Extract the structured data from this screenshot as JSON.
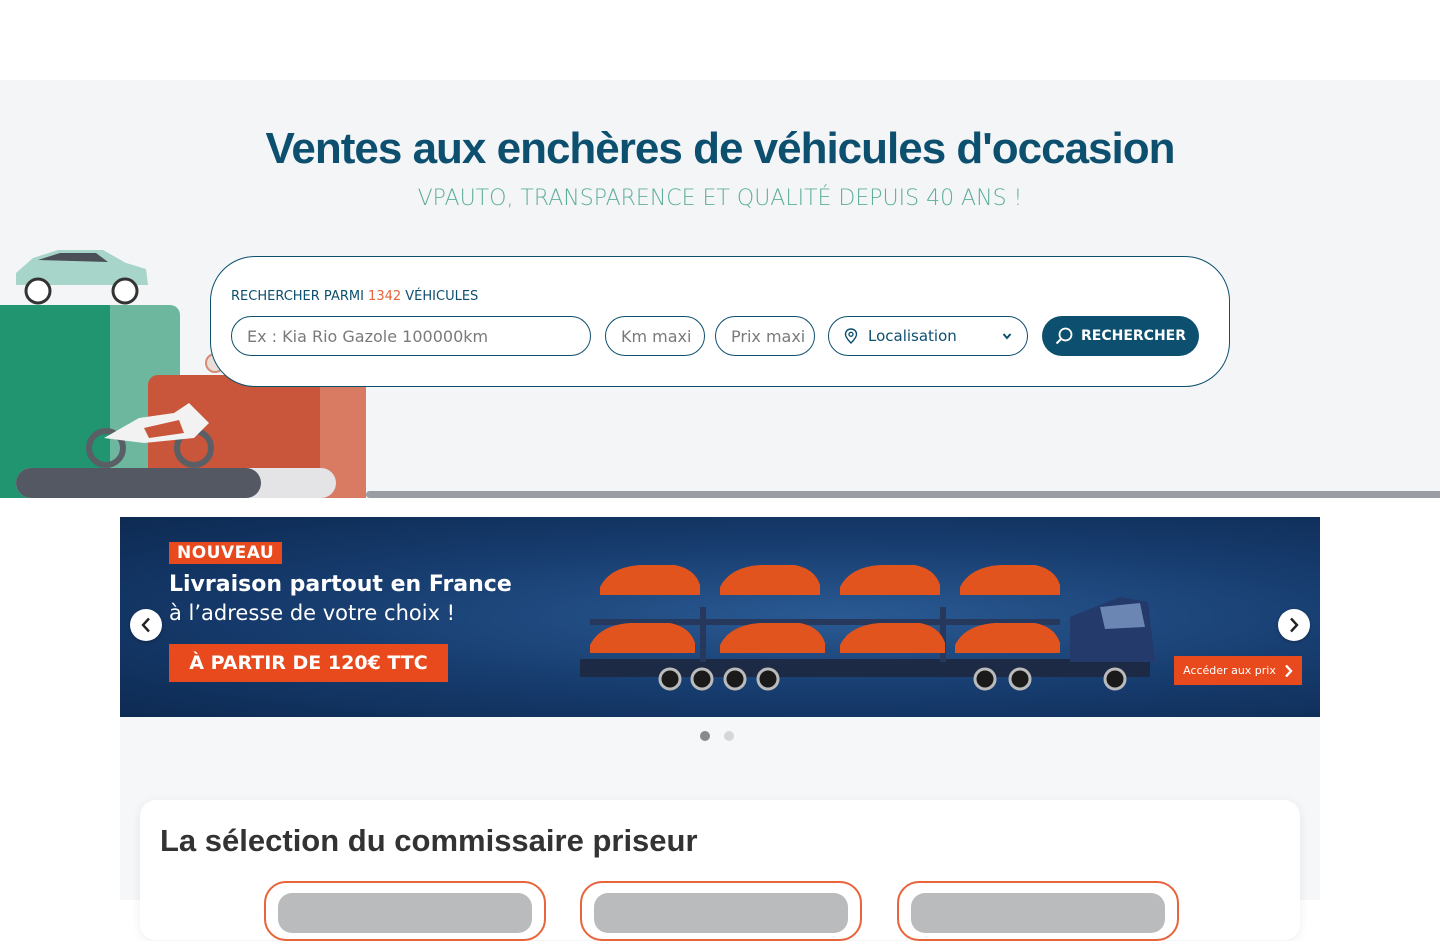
{
  "hero": {
    "title": "Ventes aux enchères de véhicules d'occasion",
    "subtitle": "VPAUTO, TRANSPARENCE ET QUALITÉ DEPUIS 40 ANS !"
  },
  "search": {
    "count_prefix": "RECHERCHER PARMI ",
    "count_value": "1342",
    "count_suffix": " VÉHICULES",
    "query_placeholder": "Ex : Kia Rio Gazole 100000km",
    "km_placeholder": "Km maxi",
    "price_placeholder": "Prix maxi",
    "location_label": "Localisation",
    "submit_label": "RECHERCHER"
  },
  "banner": {
    "badge": "NOUVEAU",
    "headline": "Livraison partout en France",
    "subline": "à l’adresse de votre choix !",
    "price_label": "À PARTIR DE 120€ TTC",
    "cta_label": "Accéder aux prix",
    "slide_count": 2,
    "active_slide": 1
  },
  "selection": {
    "title": "La sélection du commissaire priseur"
  },
  "colors": {
    "brand_dark": "#0d4f6e",
    "brand_teal": "#5fae9a",
    "accent_orange": "#e8643a"
  }
}
